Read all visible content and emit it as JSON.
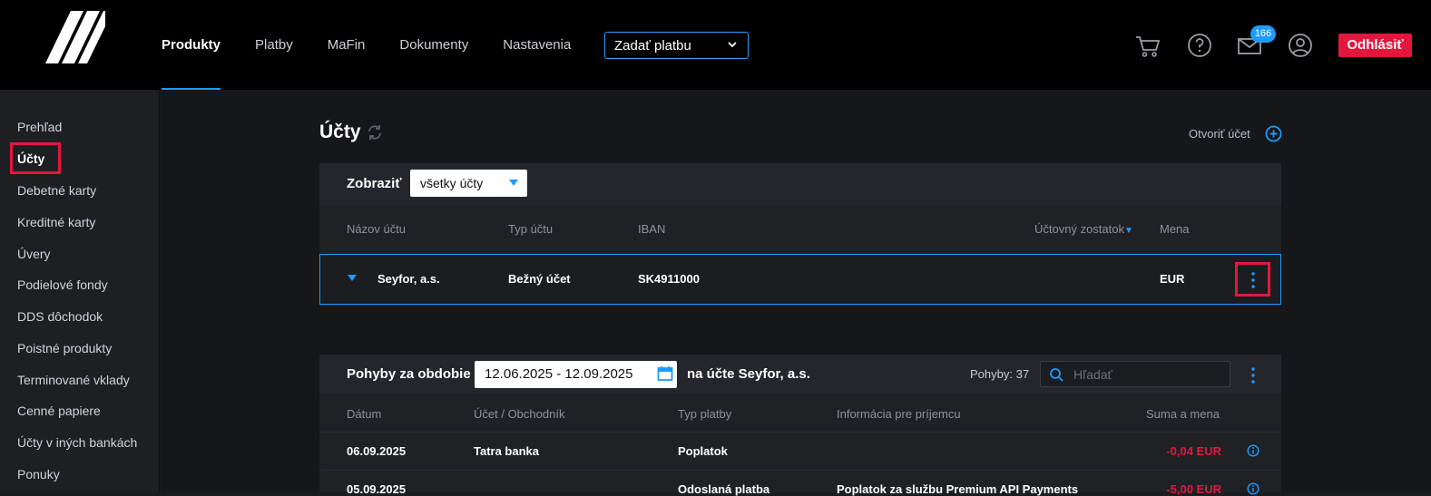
{
  "header": {
    "nav": [
      "Produkty",
      "Platby",
      "MaFin",
      "Dokumenty",
      "Nastavenia"
    ],
    "active_nav": "Produkty",
    "pay_select": "Zadať platbu",
    "messages_count": "166",
    "logout": "Odhlásiť"
  },
  "sidebar": {
    "items": [
      "Prehľad",
      "Účty",
      "Debetné karty",
      "Kreditné karty",
      "Úvery",
      "Podielové fondy",
      "DDS dôchodok",
      "Poistné produkty",
      "Terminované vklady",
      "Cenné papiere",
      "Účty v iných bankách",
      "Ponuky"
    ],
    "active": "Účty"
  },
  "accounts": {
    "title": "Účty",
    "open_account": "Otvoriť účet",
    "show_label": "Zobraziť",
    "show_value": "všetky účty",
    "columns": [
      "Názov účtu",
      "Typ účtu",
      "IBAN",
      "Účtovný zostatok",
      "Mena"
    ],
    "rows": [
      {
        "name": "Seyfor, a.s.",
        "type": "Bežný účet",
        "iban": "SK4911000",
        "balance": "",
        "currency": "EUR"
      }
    ]
  },
  "movements": {
    "label": "Pohyby za obdobie",
    "period": "12.06.2025 - 12.09.2025",
    "account_label": "na účte Seyfor, a.s.",
    "count_label": "Pohyby: 37",
    "search_placeholder": "Hľadať",
    "columns": [
      "Dátum",
      "Účet / Obchodník",
      "Typ platby",
      "Informácia pre príjemcu",
      "Suma a mena"
    ],
    "rows": [
      {
        "date": "06.09.2025",
        "merchant": "Tatra banka",
        "type": "Poplatok",
        "info": "",
        "amount": "-0,04 EUR"
      },
      {
        "date": "05.09.2025",
        "merchant": "",
        "type": "Odoslaná platba",
        "info": "Poplatok za službu Premium API Payments",
        "amount": "-5,00 EUR"
      }
    ]
  },
  "colors": {
    "accent": "#1e9bff",
    "danger": "#e3173e",
    "highlight": "#e3173e"
  }
}
